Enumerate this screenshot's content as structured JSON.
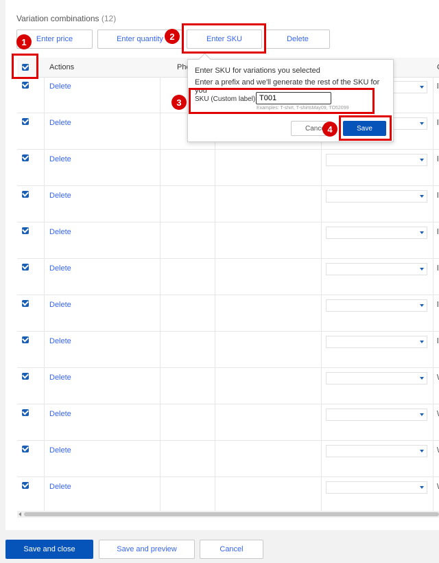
{
  "section": {
    "title": "Variation combinations",
    "count": "(12)"
  },
  "toolbar": {
    "enter_price": "Enter price",
    "enter_quantity": "Enter quantity",
    "enter_sku": "Enter SKU",
    "delete": "Delete"
  },
  "table": {
    "headers": {
      "actions": "Actions",
      "photo": "Pho",
      "extra": "C"
    },
    "rows": [
      {
        "action": "Delete",
        "edge": "l"
      },
      {
        "action": "Delete",
        "edge": "l"
      },
      {
        "action": "Delete",
        "edge": "l"
      },
      {
        "action": "Delete",
        "edge": "l"
      },
      {
        "action": "Delete",
        "edge": "l"
      },
      {
        "action": "Delete",
        "edge": "l"
      },
      {
        "action": "Delete",
        "edge": "l"
      },
      {
        "action": "Delete",
        "edge": "l"
      },
      {
        "action": "Delete",
        "edge": "\\"
      },
      {
        "action": "Delete",
        "edge": "\\"
      },
      {
        "action": "Delete",
        "edge": "\\"
      },
      {
        "action": "Delete",
        "edge": "\\"
      }
    ]
  },
  "popover": {
    "title": "Enter SKU for variations you selected",
    "subtitle": "Enter a prefix and we'll generate the rest of the SKU for you",
    "label": "SKU (Custom label)",
    "input_value": "T001",
    "hint": "Examples: T-shirt, T-shirtsMay09, TO52099",
    "cancel_label": "Cance",
    "save_label": "Save"
  },
  "annotations": {
    "one": "1",
    "two": "2",
    "three": "3",
    "four": "4"
  },
  "footer": {
    "save_close": "Save and close",
    "save_preview": "Save and preview",
    "cancel": "Cancel"
  },
  "colors": {
    "primary": "#0654ba",
    "link": "#3665f3",
    "highlight": "#e00000"
  }
}
